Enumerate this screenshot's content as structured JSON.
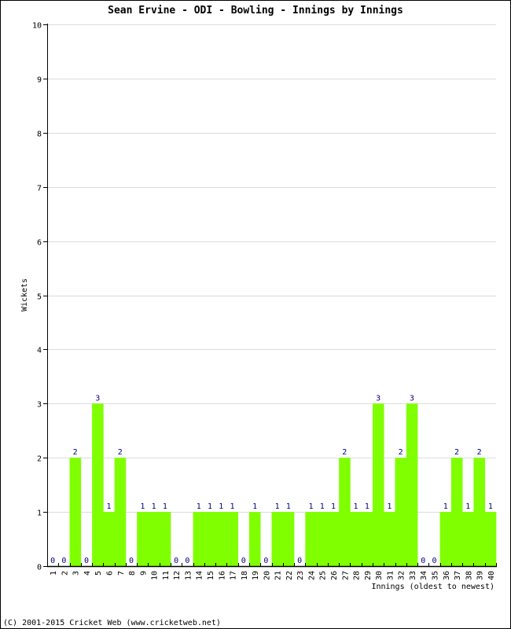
{
  "chart_data": {
    "type": "bar",
    "title": "Sean Ervine - ODI - Bowling - Innings by Innings",
    "xlabel": "Innings (oldest to newest)",
    "ylabel": "Wickets",
    "ylim": [
      0,
      10
    ],
    "yticks": [
      0,
      1,
      2,
      3,
      4,
      5,
      6,
      7,
      8,
      9,
      10
    ],
    "grid": true,
    "bar_color": "#80ff00",
    "label_color": "#000080",
    "categories": [
      "1",
      "2",
      "3",
      "4",
      "5",
      "6",
      "7",
      "8",
      "9",
      "10",
      "11",
      "12",
      "13",
      "14",
      "15",
      "16",
      "17",
      "18",
      "19",
      "20",
      "21",
      "22",
      "23",
      "24",
      "25",
      "26",
      "27",
      "28",
      "29",
      "30",
      "31",
      "32",
      "33",
      "34",
      "35",
      "36",
      "37",
      "38",
      "39",
      "40"
    ],
    "values": [
      0,
      0,
      2,
      0,
      3,
      1,
      2,
      0,
      1,
      1,
      1,
      0,
      0,
      1,
      1,
      1,
      1,
      0,
      1,
      0,
      1,
      1,
      0,
      1,
      1,
      1,
      2,
      1,
      1,
      3,
      1,
      2,
      3,
      0,
      0,
      1,
      2,
      1,
      2,
      1
    ]
  },
  "footer": "(C) 2001-2015 Cricket Web (www.cricketweb.net)"
}
